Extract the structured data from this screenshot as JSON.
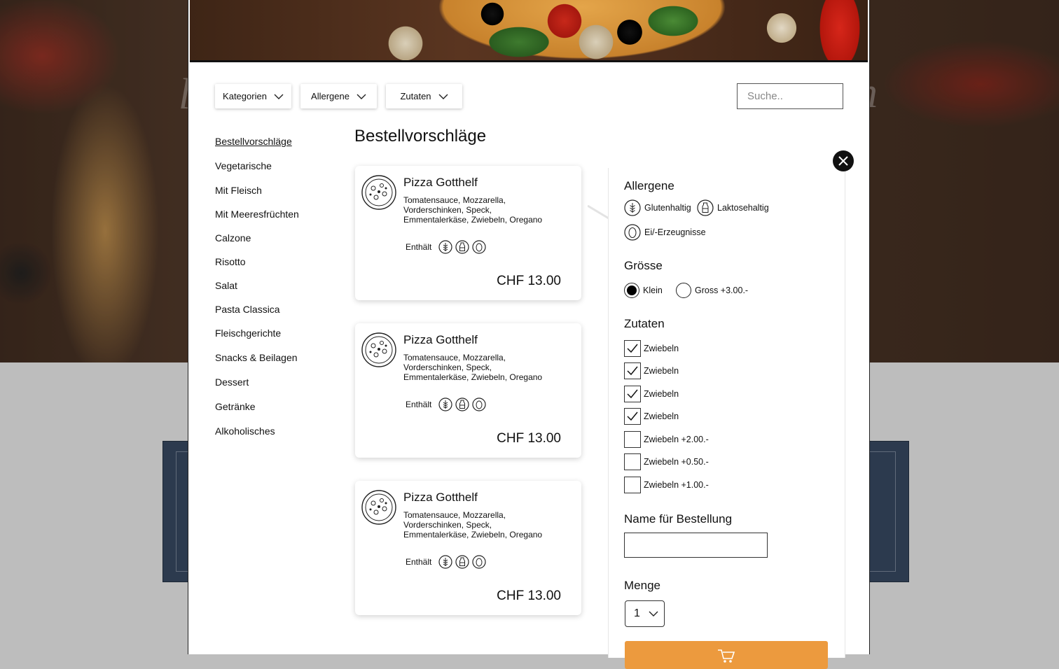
{
  "filters": {
    "categories_label": "Kategorien",
    "allergens_label": "Allergene",
    "ingredients_label": "Zutaten",
    "search_placeholder": "Suche.."
  },
  "nav": {
    "items": [
      {
        "label": "Bestellvorschläge",
        "active": true
      },
      {
        "label": "Vegetarische"
      },
      {
        "label": "Mit Fleisch"
      },
      {
        "label": "Mit Meeresfrüchten"
      },
      {
        "label": "Calzone"
      },
      {
        "label": "Risotto"
      },
      {
        "label": "Salat"
      },
      {
        "label": "Pasta Classica"
      },
      {
        "label": "Fleischgerichte"
      },
      {
        "label": "Snacks & Beilagen"
      },
      {
        "label": "Dessert"
      },
      {
        "label": "Getränke"
      },
      {
        "label": "Alkoholisches"
      }
    ]
  },
  "section_title": "Bestellvorschläge",
  "products": [
    {
      "name": "Pizza Gotthelf",
      "description": "Tomatensauce, Mozzarella, Vorderschinken, Speck, Emmentalerkäse, Zwiebeln, Oregano",
      "contains_label": "Enthält",
      "price": "CHF 13.00"
    },
    {
      "name": "Pizza Gotthelf",
      "description": "Tomatensauce, Mozzarella, Vorderschinken, Speck, Emmentalerkäse, Zwiebeln, Oregano",
      "contains_label": "Enthält",
      "price": "CHF 13.00"
    },
    {
      "name": "Pizza Gotthelf",
      "description": "Tomatensauce, Mozzarella, Vorderschinken, Speck, Emmentalerkäse, Zwiebeln, Oregano",
      "contains_label": "Enthält",
      "price": "CHF 13.00"
    }
  ],
  "detail": {
    "allergens_heading": "Allergene",
    "allergens": [
      {
        "icon": "wheat-icon",
        "label": "Glutenhaltig"
      },
      {
        "icon": "milk-bottle-icon",
        "label": "Laktosehaltig"
      },
      {
        "icon": "egg-icon",
        "label": "Ei/-Erzeugnisse"
      }
    ],
    "size_heading": "Grösse",
    "sizes": [
      {
        "label": "Klein",
        "selected": true
      },
      {
        "label": "Gross +3.00.-",
        "selected": false
      }
    ],
    "ingredients_heading": "Zutaten",
    "ingredients": [
      {
        "label": "Zwiebeln",
        "checked": true
      },
      {
        "label": "Zwiebeln",
        "checked": true
      },
      {
        "label": "Zwiebeln",
        "checked": true
      },
      {
        "label": "Zwiebeln",
        "checked": true
      },
      {
        "label": "Zwiebeln +2.00.-",
        "checked": false
      },
      {
        "label": "Zwiebeln +0.50.-",
        "checked": false
      },
      {
        "label": "Zwiebeln +1.00.-",
        "checked": false
      }
    ],
    "name_heading": "Name für Bestellung",
    "name_value": "",
    "quantity_heading": "Menge",
    "quantity_value": "1"
  },
  "colors": {
    "accent": "#ec9a3e",
    "text": "#111111",
    "bg_box": "#2c3a4e"
  }
}
